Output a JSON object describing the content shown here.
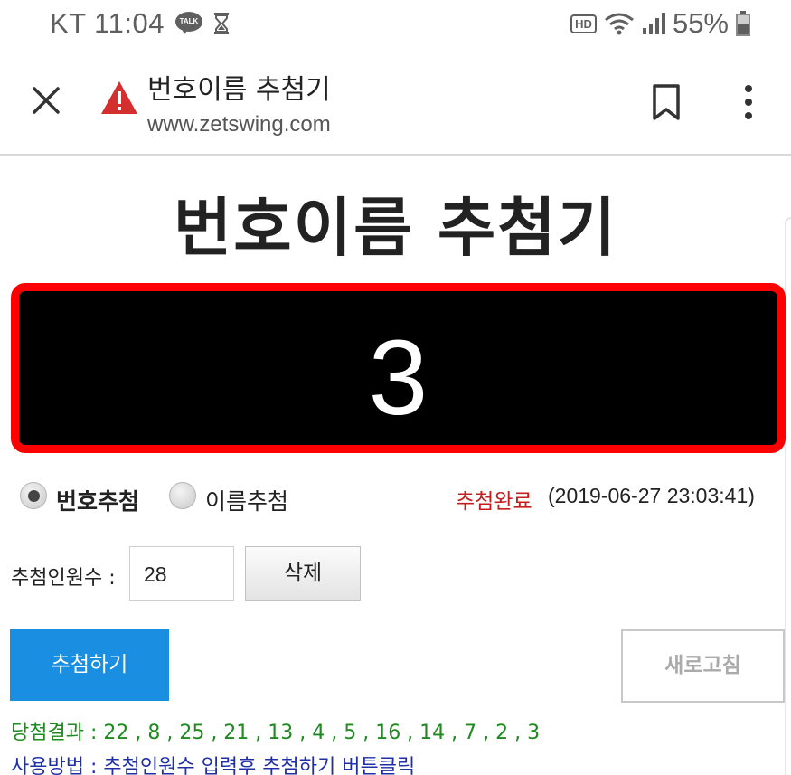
{
  "status_bar": {
    "carrier_time": "KT 11:04",
    "talk_icon_text": "TALK",
    "hd_label": "HD",
    "battery": "55%"
  },
  "app_bar": {
    "title": "번호이름 추첨기",
    "url": "www.zetswing.com"
  },
  "page": {
    "heading": "번호이름 추첨기",
    "display_number": "3",
    "mode_number_label": "번호추첨",
    "mode_name_label": "이름추첨",
    "selected_mode": "번호추첨",
    "status_text": "추첨완료",
    "status_time": "(2019-06-27 23:03:41)",
    "count_label": "추첨인원수 :",
    "count_value": "28",
    "delete_label": "삭제",
    "draw_label": "추첨하기",
    "refresh_label": "새로고침",
    "result_label": "당첨결과",
    "result_values": "22 , 8 , 25 , 21 , 13 , 4 , 5 , 16 , 14 , 7 , 2 , 3",
    "usage_label": "사용방법",
    "usage_text": "추첨인원수 입력후 추첨하기 버튼클릭"
  },
  "colors": {
    "display_border": "#ff0000",
    "display_bg": "#000000",
    "draw_button": "#1a8ee0",
    "status_done": "#c81d1d",
    "result_text": "#1f8a1f",
    "usage_text": "#1f2fa6",
    "warning": "#d32f2f"
  },
  "icons": {
    "close": "close-icon",
    "warning": "warning-icon",
    "bookmark": "bookmark-icon",
    "more": "more-vertical-icon",
    "wifi": "wifi-icon",
    "signal": "signal-icon",
    "battery": "battery-icon",
    "talk": "kakaotalk-icon",
    "hourglass": "hourglass-icon"
  }
}
